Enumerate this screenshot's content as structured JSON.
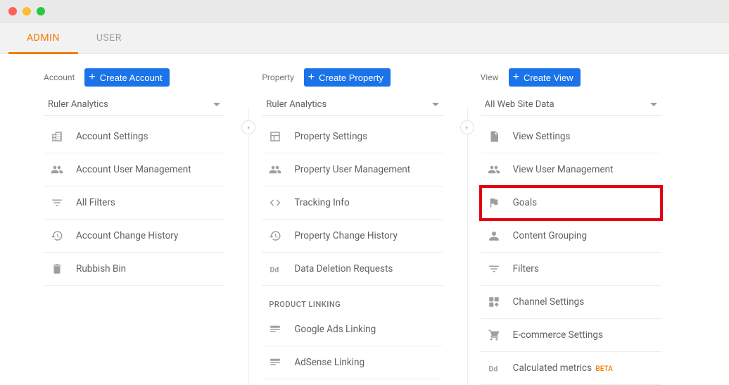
{
  "tabs": {
    "admin": "ADMIN",
    "user": "USER"
  },
  "account": {
    "label": "Account",
    "create": "Create Account",
    "dropdown": "Ruler Analytics",
    "items": [
      "Account Settings",
      "Account User Management",
      "All Filters",
      "Account Change History",
      "Rubbish Bin"
    ]
  },
  "property": {
    "label": "Property",
    "create": "Create Property",
    "dropdown": "Ruler Analytics",
    "items": [
      "Property Settings",
      "Property User Management",
      "Tracking Info",
      "Property Change History",
      "Data Deletion Requests"
    ],
    "section_heading": "PRODUCT LINKING",
    "linking_items": [
      "Google Ads Linking",
      "AdSense Linking"
    ]
  },
  "view": {
    "label": "View",
    "create": "Create View",
    "dropdown": "All Web Site Data",
    "items": [
      "View Settings",
      "View User Management",
      "Goals",
      "Content Grouping",
      "Filters",
      "Channel Settings",
      "E-commerce Settings",
      "Calculated metrics"
    ],
    "beta": "BETA"
  }
}
